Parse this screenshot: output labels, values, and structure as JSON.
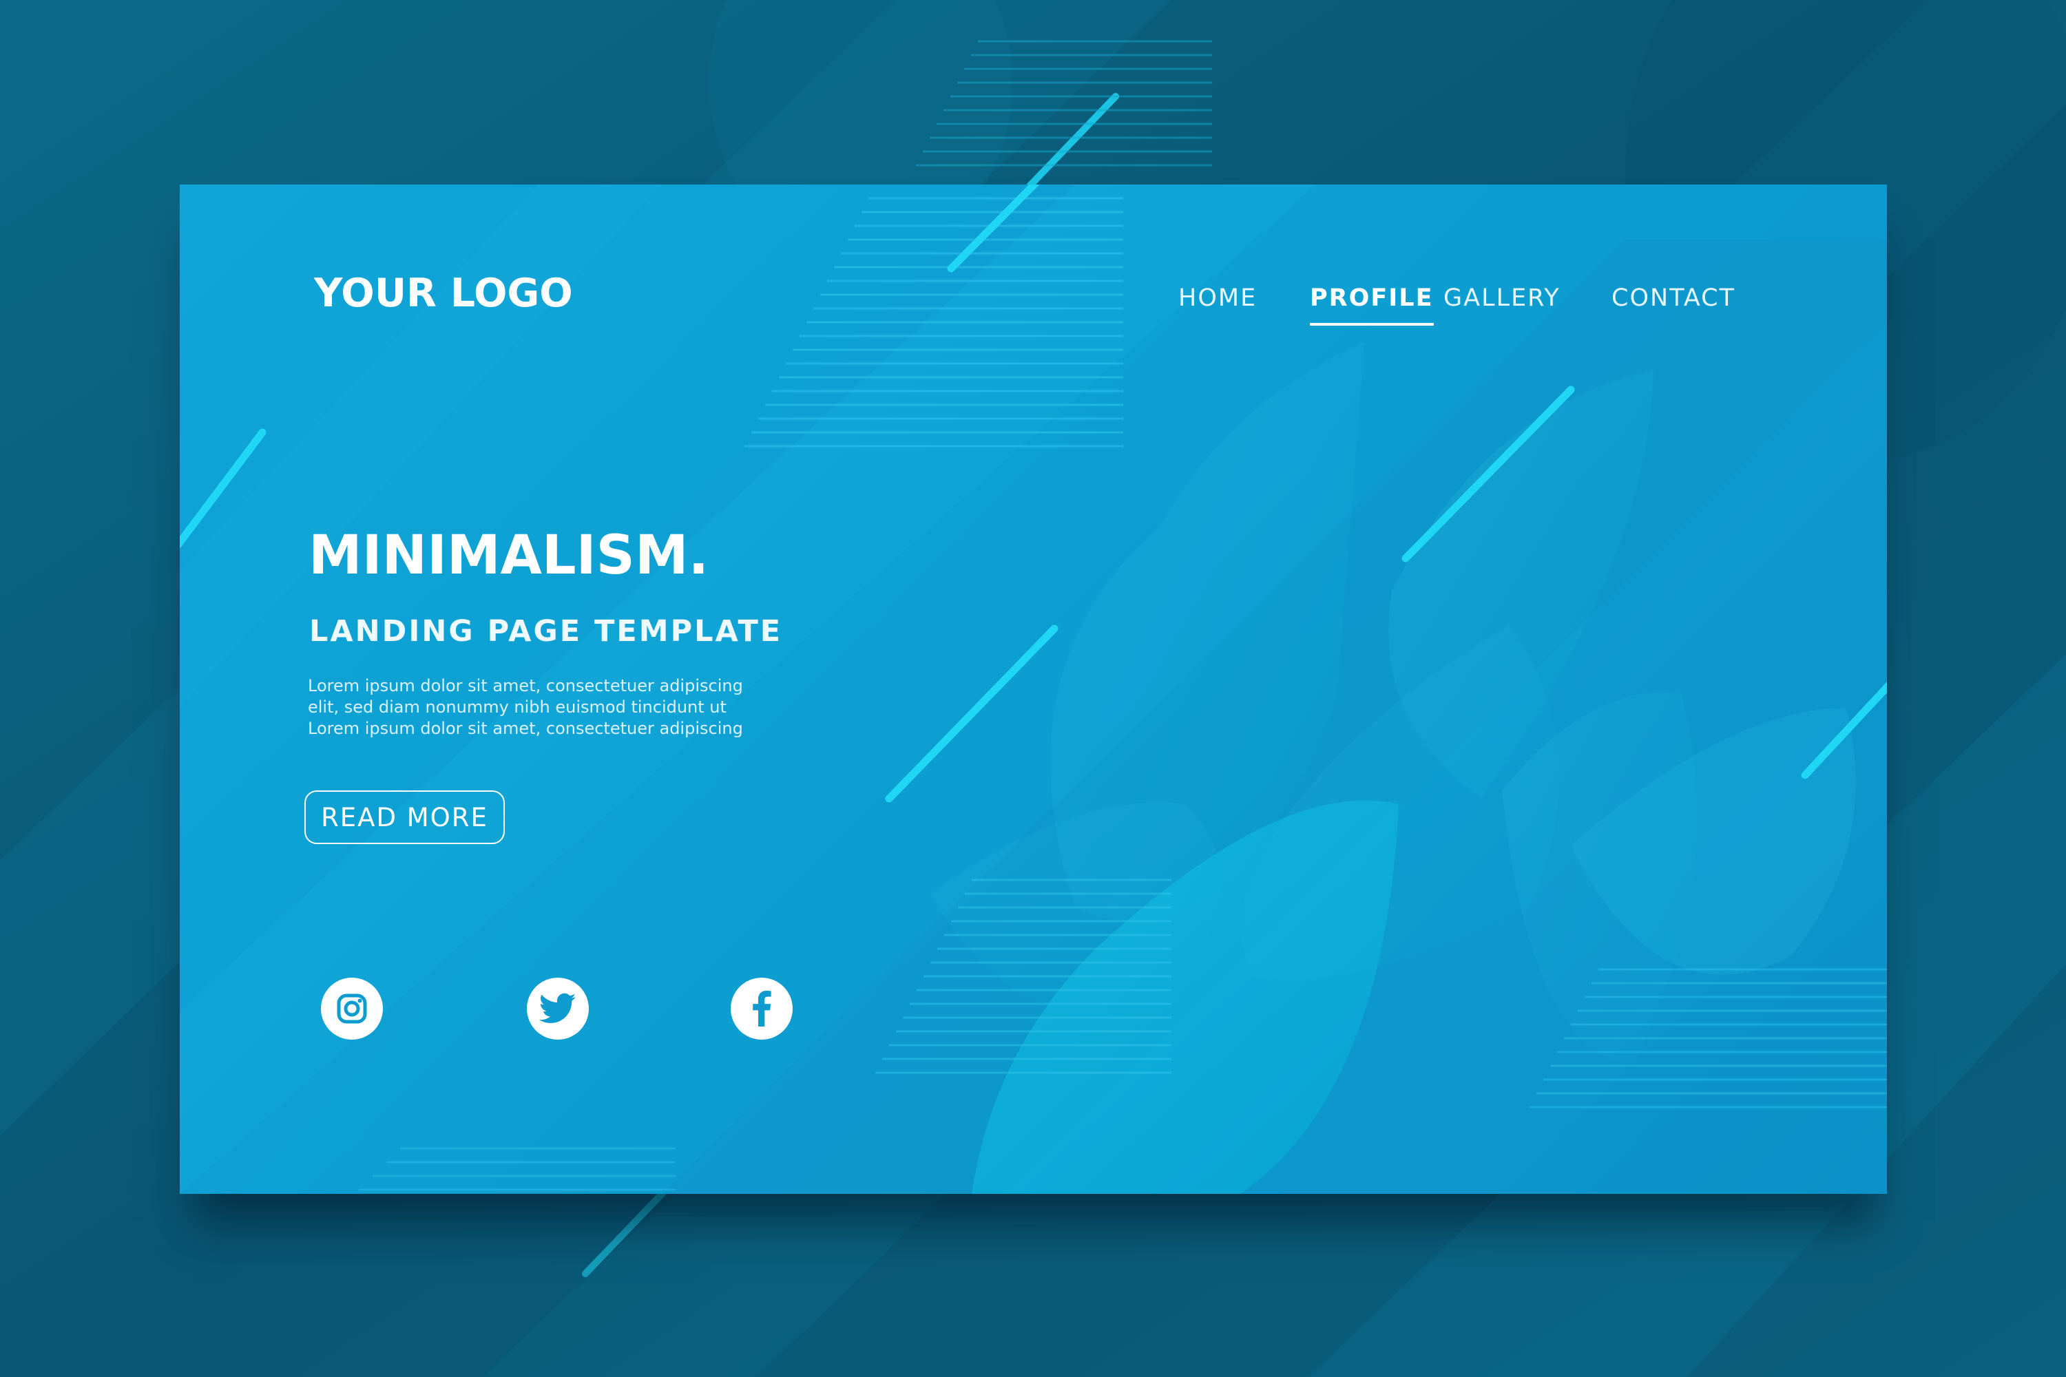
{
  "logo": {
    "text": "YOUR LOGO"
  },
  "nav": {
    "items": [
      {
        "label": "HOME",
        "active": false
      },
      {
        "label": "PROFILE",
        "active": true
      },
      {
        "label": "GALLERY",
        "active": false
      },
      {
        "label": "CONTACT",
        "active": false
      }
    ]
  },
  "hero": {
    "title": "MINIMALISM.",
    "subtitle": "LANDING PAGE TEMPLATE",
    "body_lines": [
      "Lorem ipsum dolor sit amet, consectetuer adipiscing",
      "elit, sed diam nonummy nibh euismod tincidunt ut",
      "Lorem ipsum dolor sit amet, consectetuer adipiscing"
    ],
    "cta_label": "READ MORE"
  },
  "social": [
    {
      "icon": "instagram-icon"
    },
    {
      "icon": "twitter-icon"
    },
    {
      "icon": "facebook-icon"
    }
  ],
  "colors": {
    "page_background": "#0a5a78",
    "card_background": "#10a4d8",
    "accent_lines": "#1fd6f5",
    "text": "#ffffff",
    "social_icon": "#0e9bd0"
  }
}
